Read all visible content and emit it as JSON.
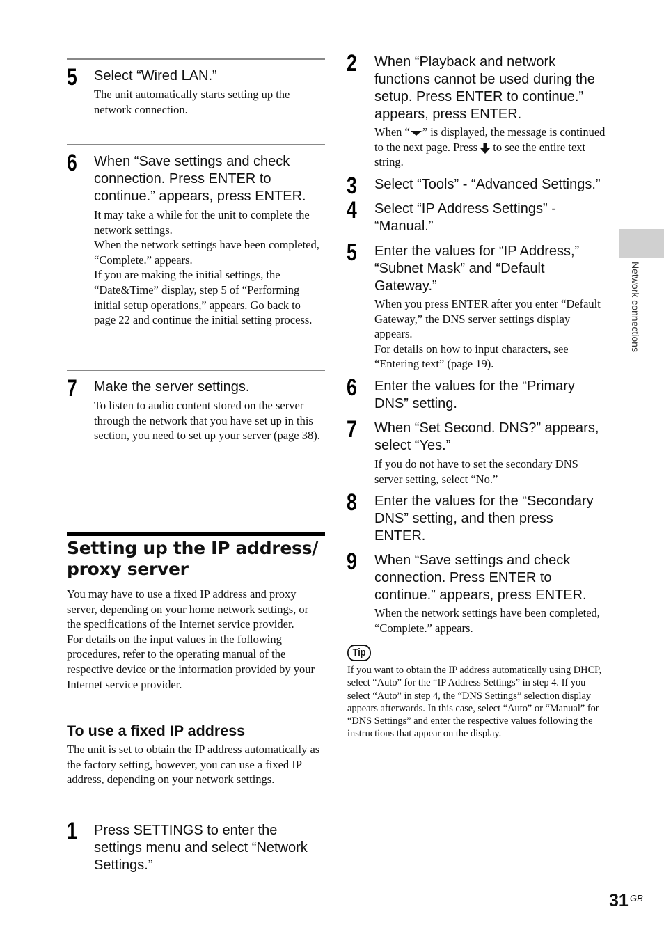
{
  "left_column": {
    "steps_top": [
      {
        "num": "5",
        "title": "Select “Wired LAN.”",
        "body": "The unit automatically starts setting up the network connection."
      },
      {
        "num": "6",
        "title": "When “Save settings and check connection. Press ENTER to continue.” appears, press ENTER.",
        "body": [
          "It may take a while for the unit to complete the network settings.",
          "When the network settings have been completed, “Complete.” appears.",
          "If you are making the initial settings, the “Date&Time” display, step 5 of “Performing initial setup operations,” appears. Go back to page 22 and continue the initial setting process."
        ]
      },
      {
        "num": "7",
        "title": "Make the server settings.",
        "body": "To listen to audio content stored on the server through the network that you have set up in this section, you need to set up your server (page 38)."
      }
    ],
    "section_title": "Setting up the IP address/ proxy server",
    "intro": [
      "You may have to use a fixed IP address and proxy server, depending on your home network settings, or the specifications of the Internet service provider.",
      "For details on the input values in the following procedures, refer to the operating manual of the respective device or the information provided by your Internet service provider."
    ],
    "subsection_title": "To use a fixed IP address",
    "subsection_body": "The unit is set to obtain the IP address automatically as the factory setting, however, you can use a fixed IP address, depending on your network settings.",
    "step1": {
      "num": "1",
      "title": "Press SETTINGS to enter the settings menu and select “Network Settings.”"
    }
  },
  "right_column": {
    "steps": [
      {
        "num": "2",
        "title": "When “Playback and network functions cannot be used during the setup. Press ENTER to continue.” appears, press ENTER.",
        "body_parts": {
          "a": "When “",
          "b": "” is displayed, the message is continued to the next page. Press",
          "c": "to see the entire text string."
        }
      },
      {
        "num": "3",
        "title": "Select “Tools” - “Advanced Settings.”"
      },
      {
        "num": "4",
        "title": "Select “IP Address Settings” - “Manual.”"
      },
      {
        "num": "5",
        "title": "Enter the values for “IP Address,” “Subnet Mask” and “Default Gateway.”",
        "body": [
          "When you press ENTER after you enter “Default Gateway,” the DNS server settings display appears.",
          "For details on how to input characters, see “Entering text” (page 19)."
        ]
      },
      {
        "num": "6",
        "title": "Enter the values for the “Primary DNS” setting."
      },
      {
        "num": "7",
        "title": "When “Set Second. DNS?” appears, select “Yes.”",
        "body": "If you do not have to set the secondary DNS server setting, select “No.”"
      },
      {
        "num": "8",
        "title": "Enter the values for the “Secondary DNS” setting, and then press ENTER."
      },
      {
        "num": "9",
        "title": "When “Save settings and check connection. Press ENTER to continue.” appears, press ENTER.",
        "body": "When the network settings have been completed, “Complete.” appears."
      }
    ],
    "tip": {
      "label": "Tip",
      "body": "If you want to obtain the IP address automatically using DHCP, select “Auto” for the “IP Address Settings” in step 4. If you select “Auto” in step 4, the “DNS Settings” selection display appears afterwards. In this case, select “Auto” or “Manual” for “DNS Settings” and enter the respective values following the instructions that appear on the display."
    }
  },
  "side_tab": {
    "label": "Network connections"
  },
  "footer": {
    "page": "31",
    "suffix": "GB"
  }
}
